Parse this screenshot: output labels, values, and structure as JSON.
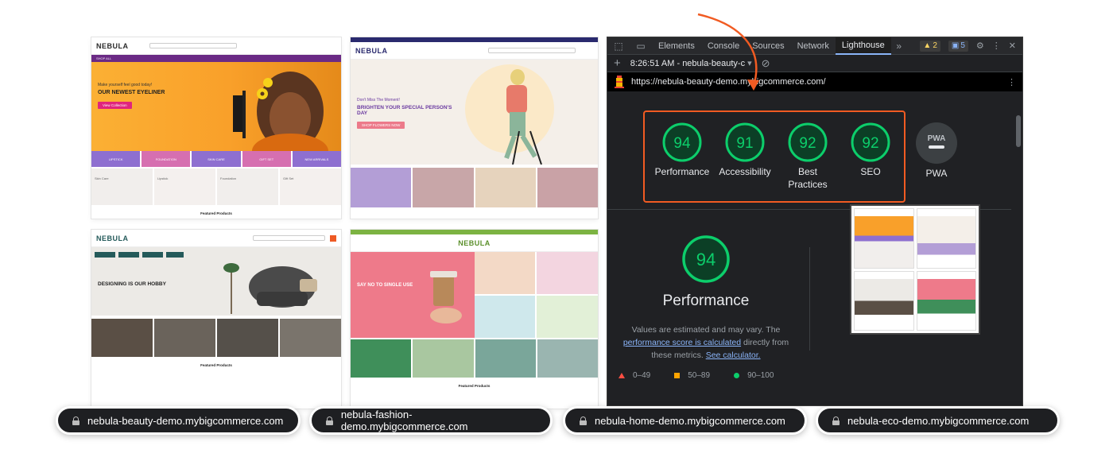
{
  "thumbnails": {
    "beauty": {
      "logo": "NEBULA",
      "nav_first": "SHOP ALL",
      "hero_small": "Make yourself feel good today!",
      "hero_big": "OUR NEWEST EYELINER",
      "hero_button": "View Collection",
      "categories": [
        "LIPSTICK",
        "FOUNDATION",
        "SKIN CARE",
        "GIFT SET",
        "NEW ARRIVALS"
      ],
      "tiles": [
        "Skin Care",
        "Lipstick",
        "Foundation",
        "Gift Set"
      ],
      "featured": "Featured Products"
    },
    "fashion": {
      "logo": "NEBULA",
      "hero_small": "Don't Miss The Moment!",
      "hero_big": "BRIGHTEN YOUR SPECIAL PERSON'S DAY",
      "hero_button": "SHOP FLOWERS NOW"
    },
    "home": {
      "logo": "NEBULA",
      "hero_big": "DESIGNING IS OUR HOBBY",
      "featured": "Featured Products"
    },
    "eco": {
      "logo": "NEBULA",
      "hero_big": "SAY NO TO SINGLE USE",
      "featured": "Featured Products"
    }
  },
  "devtools": {
    "tabs": [
      "Elements",
      "Console",
      "Sources",
      "Network",
      "Lighthouse"
    ],
    "active_tab": "Lighthouse",
    "warnings": "2",
    "messages": "5",
    "report_time": "8:26:51 AM - nebula-beauty-c",
    "url": "https://nebula-beauty-demo.mybigcommerce.com/",
    "scores": [
      {
        "label": "Performance",
        "value": 94
      },
      {
        "label": "Accessibility",
        "value": 91
      },
      {
        "label": "Best Practices",
        "value": 92
      },
      {
        "label": "SEO",
        "value": 92
      }
    ],
    "pwa_label": "PWA",
    "pwa_badge": "PWA",
    "performance": {
      "score": 94,
      "title": "Performance",
      "desc_1": "Values are estimated and may vary. The",
      "link_1": "performance score is calculated",
      "desc_2": "directly from these metrics.",
      "link_2": "See calculator."
    },
    "legend": [
      "0–49",
      "50–89",
      "90–100"
    ]
  },
  "url_pills": [
    "nebula-beauty-demo.mybigcommerce.com",
    "nebula-fashion-demo.mybigcommerce.com",
    "nebula-home-demo.mybigcommerce.com",
    "nebula-eco-demo.mybigcommerce.com"
  ],
  "colors": {
    "gauge_green": "#0cce6b",
    "highlight_orange": "#f15b22",
    "beauty_purple": "#6b2a85"
  }
}
